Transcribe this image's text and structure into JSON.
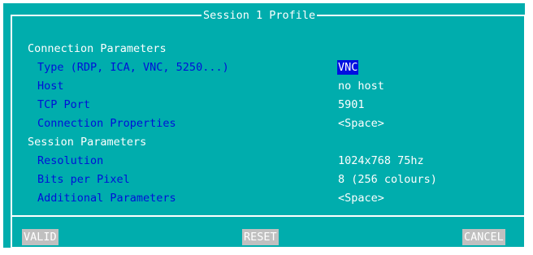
{
  "dialog": {
    "title": "Session 1 Profile"
  },
  "sections": {
    "connection": "Connection Parameters",
    "session": "Session Parameters"
  },
  "fields": {
    "type": {
      "label": "Type (RDP, ICA, VNC, 5250...)",
      "value": "VNC"
    },
    "host": {
      "label": "Host",
      "value": "no host"
    },
    "tcp_port": {
      "label": "TCP Port",
      "value": "5901"
    },
    "connection_properties": {
      "label": "Connection Properties",
      "value": "<Space>"
    },
    "resolution": {
      "label": "Resolution",
      "value": "1024x768 75hz"
    },
    "bits_per_pixel": {
      "label": "Bits per Pixel",
      "value": "8 (256 colours)"
    },
    "additional_parameters": {
      "label": "Additional Parameters",
      "value": "<Space>"
    }
  },
  "buttons": {
    "valid": "VALID",
    "reset": "RESET",
    "cancel": "CANCEL"
  },
  "colors": {
    "background": "#00adad",
    "label": "#0010d8",
    "text": "#ffffff",
    "selection": "#0010e0",
    "button": "#c0c0c0"
  }
}
